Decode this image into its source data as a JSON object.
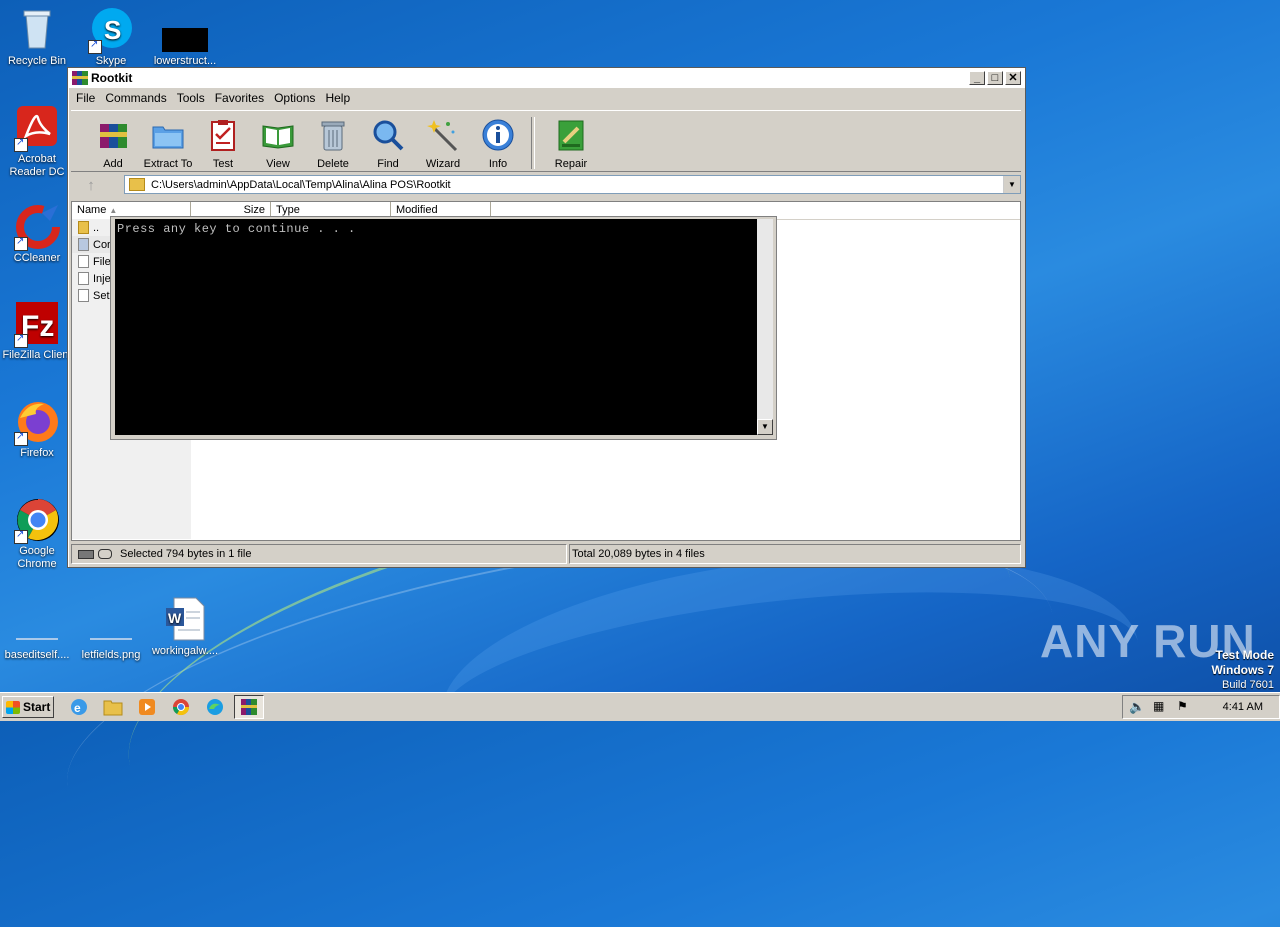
{
  "desktop": {
    "icons": [
      {
        "label": "Recycle Bin"
      },
      {
        "label": "Skype"
      },
      {
        "label": "lowerstruct..."
      },
      {
        "label": "Acrobat Reader DC"
      },
      {
        "label": "CCleaner"
      },
      {
        "label": "FileZilla Client"
      },
      {
        "label": "Firefox"
      },
      {
        "label": "Google Chrome"
      },
      {
        "label": "baseditself...."
      },
      {
        "label": "letfields.png"
      },
      {
        "label": "workingalw...."
      }
    ]
  },
  "window": {
    "title": "Rootkit",
    "menu": [
      "File",
      "Commands",
      "Tools",
      "Favorites",
      "Options",
      "Help"
    ],
    "toolbar": [
      "Add",
      "Extract To",
      "Test",
      "View",
      "Delete",
      "Find",
      "Wizard",
      "Info",
      "Repair"
    ],
    "path": "C:\\Users\\admin\\AppData\\Local\\Temp\\Alina\\Alina POS\\Rootkit",
    "columns": [
      "Name",
      "Size",
      "Type",
      "Modified"
    ],
    "files": [
      "..",
      "Cor",
      "File",
      "Inje",
      "Set"
    ],
    "status_left": "Selected 794 bytes in 1 file",
    "status_right": "Total 20,089 bytes in 4 files"
  },
  "console": {
    "text": "Press any key to continue . . ."
  },
  "taskbar": {
    "start_label": "Start",
    "clock": "4:41 AM"
  },
  "watermark": {
    "brand": "ANY RUN",
    "line1": "Test Mode",
    "line2": "Windows 7",
    "line3": "Build 7601"
  }
}
